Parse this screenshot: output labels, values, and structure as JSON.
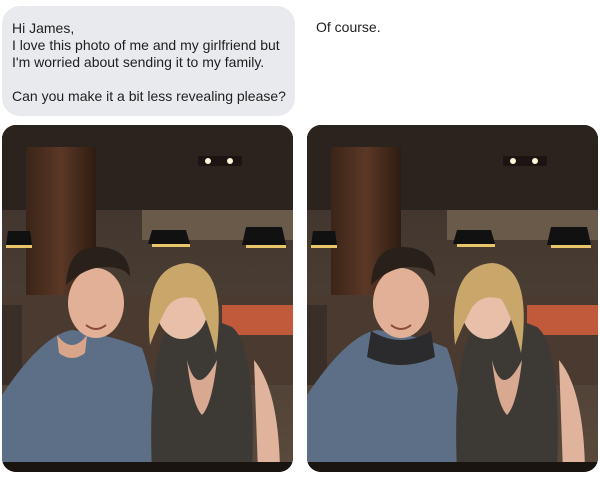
{
  "chat": {
    "user_message": {
      "greeting": "Hi James,",
      "line1": "I love this photo of me and my girlfriend but",
      "line2": "I'm worried about sending it to my family.",
      "request": "Can you make it a bit less revealing please?"
    },
    "reply_message": "Of course."
  },
  "images": {
    "original": {
      "icon": "photo-original",
      "edited": false
    },
    "edited": {
      "icon": "photo-edited",
      "edited": true
    }
  },
  "colors": {
    "bubble": "#e9eaee",
    "text": "#1f1f1f"
  }
}
